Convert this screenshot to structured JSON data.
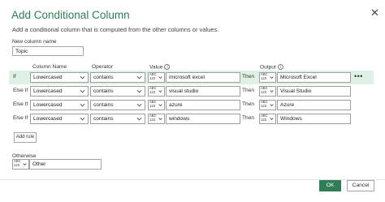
{
  "dialog": {
    "title": "Add Conditional Column",
    "close_glyph": "✕",
    "subtitle": "Add a conditional column that is computed from the other columns or values."
  },
  "new_column": {
    "label": "New column name",
    "value": "Topic"
  },
  "headers": {
    "column_name": "Column Name",
    "operator": "Operator",
    "value": "Value",
    "output": "Output",
    "info_glyph": "i"
  },
  "type_icon": {
    "top": "ABC",
    "bottom": "123"
  },
  "rules": [
    {
      "label": "If",
      "column": "Lowercased",
      "operator": "contains",
      "value": "microsoft excel",
      "then": "Then",
      "output": "Microsoft  Excel",
      "more": "•••"
    },
    {
      "label": "Else If",
      "column": "Lowercased",
      "operator": "contains",
      "value": "visual studio",
      "then": "Then",
      "output": "Visual Studio"
    },
    {
      "label": "Else If",
      "column": "Lowercased",
      "operator": "contains",
      "value": "azure",
      "then": "Then",
      "output": "Azure"
    },
    {
      "label": "Else If",
      "column": "Lowercased",
      "operator": "contains",
      "value": "windows",
      "then": "Then",
      "output": "Windows"
    }
  ],
  "add_rule_label": "Add rule",
  "otherwise": {
    "label": "Otherwise",
    "value": "Other"
  },
  "buttons": {
    "ok": "OK",
    "cancel": "Cancel"
  },
  "colors": {
    "accent": "#2f7e58",
    "row_highlight": "#dff0e4"
  },
  "icons": {
    "dropdown": "chevron-down-icon",
    "type": "abc-123-type-icon",
    "info": "info-icon",
    "close": "close-icon",
    "more": "ellipsis-icon"
  }
}
